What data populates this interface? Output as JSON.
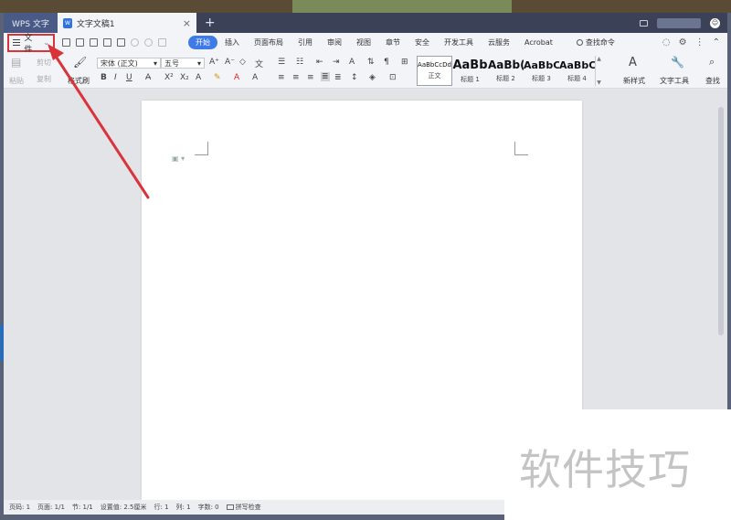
{
  "titlebar": {
    "app_tab": "WPS 文字",
    "doc_tab": "文字文稿1",
    "doc_icon_glyph": "W",
    "close_glyph": "×",
    "new_tab_glyph": "+"
  },
  "menubar": {
    "file_label": "文件",
    "tabs": [
      "开始",
      "插入",
      "页面布局",
      "引用",
      "审阅",
      "视图",
      "章节",
      "安全",
      "开发工具",
      "云服务",
      "Acrobat"
    ],
    "active_tab_index": 0,
    "search_label": "查找命令"
  },
  "ribbon": {
    "paste": "粘贴",
    "cut": "剪切",
    "copy": "复制",
    "format_painter": "格式刷",
    "font_name": "宋体 (正文)",
    "font_size": "五号",
    "bold": "B",
    "italic": "I",
    "underline": "U",
    "styles": [
      {
        "sample": "AaBbCcDd",
        "label": "正文"
      },
      {
        "sample": "AaBb",
        "label": "标题 1"
      },
      {
        "sample": "AaBb(",
        "label": "标题 2"
      },
      {
        "sample": "AaBbC(",
        "label": "标题 3"
      },
      {
        "sample": "AaBbC",
        "label": "标题 4"
      }
    ],
    "new_style": "新样式",
    "text_tools": "文字工具",
    "find_replace": "查找"
  },
  "statusbar": {
    "page_num": "页码: 1",
    "page": "页面: 1/1",
    "section": "节: 1/1",
    "settings": "设置值: 2.5厘米",
    "row": "行: 1",
    "col": "列: 1",
    "word_count": "字数: 0",
    "spell_check": "拼写检查"
  },
  "watermark": {
    "text": "软件技巧"
  },
  "colors": {
    "accent": "#3f7be8",
    "highlight_box": "#d8343a",
    "arrow": "#d8343a"
  }
}
